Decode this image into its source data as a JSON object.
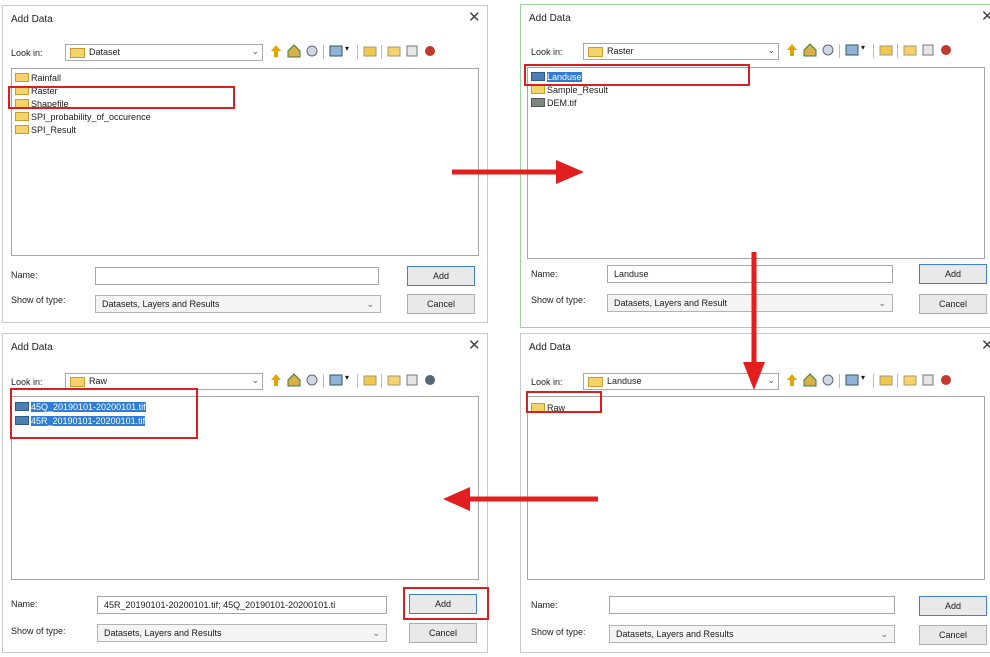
{
  "dialogs": [
    {
      "title": "Add Data",
      "close": "✕",
      "look_in_label": "Look in:",
      "look_in_value": "Dataset",
      "items": [
        "Rainfall",
        "Raster",
        "Shapefile",
        "SPI_probability_of_occurence",
        "SPI_Result"
      ],
      "name_label": "Name:",
      "name_value": "",
      "type_label": "Show of type:",
      "type_value": "Datasets, Layers and Results",
      "add_label": "Add",
      "cancel_label": "Cancel"
    },
    {
      "title": "Add Data",
      "close": "✕",
      "look_in_label": "Look in:",
      "look_in_value": "Raster",
      "items": [
        "Landuse",
        "Sample_Result",
        "DEM.tif"
      ],
      "name_label": "Name:",
      "name_value": "Landuse",
      "type_label": "Show of type:",
      "type_value": "Datasets, Layers and Result",
      "add_label": "Add",
      "cancel_label": "Cancel"
    },
    {
      "title": "Add Data",
      "close": "✕",
      "look_in_label": "Look in:",
      "look_in_value": "Raw",
      "items": [
        "45Q_20190101-20200101.tif",
        "45R_20190101-20200101.tif"
      ],
      "name_label": "Name:",
      "name_value": "45R_20190101-20200101.tif; 45Q_20190101-20200101.ti",
      "type_label": "Show of type:",
      "type_value": "Datasets, Layers and Results",
      "add_label": "Add",
      "cancel_label": "Cancel"
    },
    {
      "title": "Add Data",
      "close": "✕",
      "look_in_label": "Look in:",
      "look_in_value": "Landuse",
      "items": [
        "Raw"
      ],
      "name_label": "Name:",
      "name_value": "",
      "type_label": "Show of type:",
      "type_value": "Datasets, Layers and Results",
      "add_label": "Add",
      "cancel_label": "Cancel"
    }
  ],
  "colors": {
    "highlight": "#d92020",
    "arrow": "#e31e1e",
    "selection": "#2e7cd6",
    "folder": "#f3d36a"
  },
  "icons": [
    "folder-icon",
    "up-one-level-icon",
    "home-icon",
    "connect-folder-icon",
    "view-icon",
    "new-folder-icon",
    "catalog-icon",
    "raster-icon"
  ]
}
